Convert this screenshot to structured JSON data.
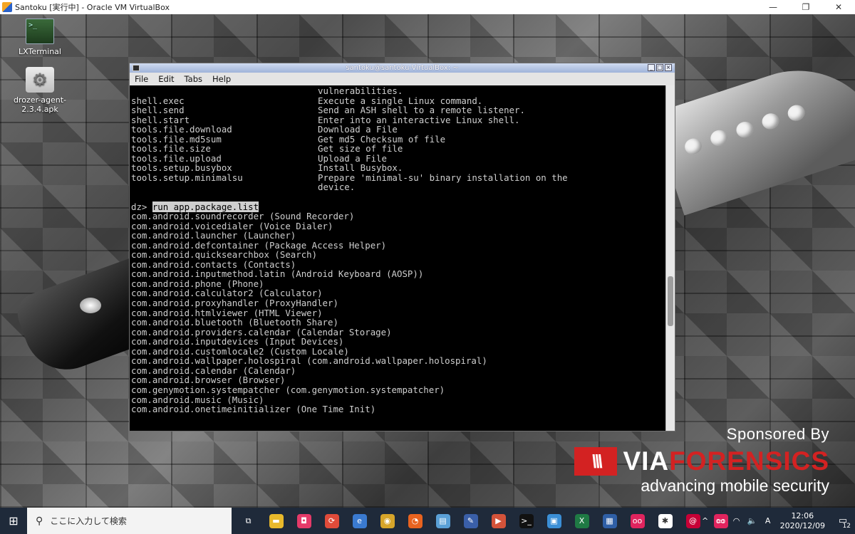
{
  "vbox_window": {
    "title": "Santoku [実行中] - Oracle VM VirtualBox",
    "minimize": "—",
    "restore": "❐",
    "close": "✕"
  },
  "desktop_icons": [
    {
      "label": "LXTerminal",
      "icon": "terminal-icon"
    },
    {
      "label": "drozer-agent-2.3.4.apk",
      "icon": "gear-icon"
    }
  ],
  "terminal": {
    "title": "santoku@santoku-VirtualBox: ~",
    "menu": [
      "File",
      "Edit",
      "Tabs",
      "Help"
    ],
    "module_lines": [
      {
        "cmd": "",
        "desc": "vulnerabilities."
      },
      {
        "cmd": "shell.exec",
        "desc": "Execute a single Linux command."
      },
      {
        "cmd": "shell.send",
        "desc": "Send an ASH shell to a remote listener."
      },
      {
        "cmd": "shell.start",
        "desc": "Enter into an interactive Linux shell."
      },
      {
        "cmd": "tools.file.download",
        "desc": "Download a File"
      },
      {
        "cmd": "tools.file.md5sum",
        "desc": "Get md5 Checksum of file"
      },
      {
        "cmd": "tools.file.size",
        "desc": "Get size of file"
      },
      {
        "cmd": "tools.file.upload",
        "desc": "Upload a File"
      },
      {
        "cmd": "tools.setup.busybox",
        "desc": "Install Busybox."
      },
      {
        "cmd": "tools.setup.minimalsu",
        "desc": "Prepare 'minimal-su' binary installation on the"
      },
      {
        "cmd": "",
        "desc": "device."
      }
    ],
    "prompt": "dz> ",
    "command": "run app.package.list",
    "package_lines": [
      "com.android.soundrecorder (Sound Recorder)",
      "com.android.voicedialer (Voice Dialer)",
      "com.android.launcher (Launcher)",
      "com.android.defcontainer (Package Access Helper)",
      "com.android.quicksearchbox (Search)",
      "com.android.contacts (Contacts)",
      "com.android.inputmethod.latin (Android Keyboard (AOSP))",
      "com.android.phone (Phone)",
      "com.android.calculator2 (Calculator)",
      "com.android.proxyhandler (ProxyHandler)",
      "com.android.htmlviewer (HTML Viewer)",
      "com.android.bluetooth (Bluetooth Share)",
      "com.android.providers.calendar (Calendar Storage)",
      "com.android.inputdevices (Input Devices)",
      "com.android.customlocale2 (Custom Locale)",
      "com.android.wallpaper.holospiral (com.android.wallpaper.holospiral)",
      "com.android.calendar (Calendar)",
      "com.android.browser (Browser)",
      "com.genymotion.systempatcher (com.genymotion.systempatcher)",
      "com.android.music (Music)",
      "com.android.onetimeinitializer (One Time Init)"
    ]
  },
  "sponsor": {
    "sponsored_by": "Sponsored By",
    "logo_mark": "\\\\\\",
    "brand_via": "VIA",
    "brand_forensics": "FORENSICS",
    "tagline": "advancing mobile security"
  },
  "taskbar": {
    "search_placeholder": "ここに入力して検索",
    "apps": [
      {
        "name": "task-view-icon",
        "glyph": "⧉",
        "color": "transparent"
      },
      {
        "name": "file-explorer-icon",
        "glyph": "▬",
        "color": "#e8b92b"
      },
      {
        "name": "red-app-icon",
        "glyph": "◘",
        "color": "#e53a69"
      },
      {
        "name": "sync-app-icon",
        "glyph": "⟳",
        "color": "#e04b3a"
      },
      {
        "name": "edge-legacy-icon",
        "glyph": "e",
        "color": "#3a7ad0"
      },
      {
        "name": "chrome-icon",
        "glyph": "◉",
        "color": "#d6a52a"
      },
      {
        "name": "firefox-icon",
        "glyph": "◔",
        "color": "#e8631f"
      },
      {
        "name": "notes-app-icon",
        "glyph": "▤",
        "color": "#5aa0d6"
      },
      {
        "name": "pen-app-icon",
        "glyph": "✎",
        "color": "#3a5fa8"
      },
      {
        "name": "slides-app-icon",
        "glyph": "▶",
        "color": "#d4533a"
      },
      {
        "name": "terminal-app-icon",
        "glyph": ">_",
        "color": "#111111"
      },
      {
        "name": "photos-app-icon",
        "glyph": "▣",
        "color": "#3b8fd6"
      },
      {
        "name": "excel-icon",
        "glyph": "X",
        "color": "#1f7a44"
      },
      {
        "name": "virtualbox-icon",
        "glyph": "▦",
        "color": "#2f5fa6"
      },
      {
        "name": "flickr-app-icon",
        "glyph": "oo",
        "color": "#e0245e"
      },
      {
        "name": "slack-icon",
        "glyph": "✱",
        "color": "#ffffff"
      },
      {
        "name": "debian-app-icon",
        "glyph": "@",
        "color": "#c70036"
      },
      {
        "name": "circle-app-icon",
        "glyph": "oo",
        "color": "#e0245e"
      }
    ],
    "tray_icons": [
      "^",
      "▭",
      "◠",
      "🔈",
      "A"
    ],
    "time": "12:06",
    "date": "2020/12/09",
    "notification_count": "12"
  }
}
